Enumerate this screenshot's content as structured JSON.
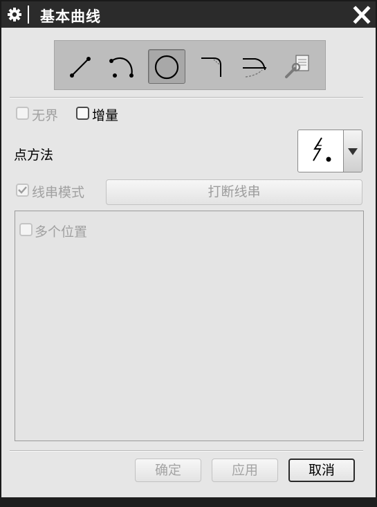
{
  "window": {
    "title": "基本曲线"
  },
  "toolbar": {
    "tools": [
      {
        "icon": "line-icon",
        "active": false
      },
      {
        "icon": "arc-icon",
        "active": false
      },
      {
        "icon": "circle-icon",
        "active": true
      },
      {
        "icon": "fillet-icon",
        "active": false
      },
      {
        "icon": "trim-icon",
        "active": false
      },
      {
        "icon": "edit-curve-parameters-icon",
        "active": false
      }
    ]
  },
  "options": {
    "unbounded_label": "无界",
    "unbounded_checked": false,
    "unbounded_enabled": false,
    "incremental_label": "增量",
    "incremental_checked": false,
    "incremental_enabled": true
  },
  "point_method": {
    "label": "点方法",
    "selected_icon": "inferred-point-icon"
  },
  "string_mode": {
    "label": "线串模式",
    "checked": true,
    "enabled": false,
    "break_button_label": "打断线串"
  },
  "panel": {
    "multiple_positions_label": "多个位置",
    "multiple_positions_checked": false
  },
  "buttons": {
    "ok_label": "确定",
    "apply_label": "应用",
    "cancel_label": "取消"
  },
  "colors": {
    "titlebar": "#2b2b2b",
    "dialog_bg": "#e6e6e6",
    "disabled_text": "#a0a0a0"
  }
}
